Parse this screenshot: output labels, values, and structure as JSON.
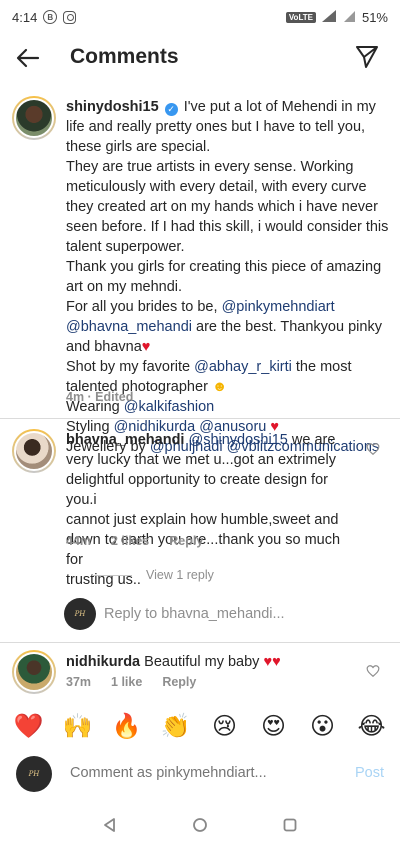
{
  "status_bar": {
    "time": "4:14",
    "battery": "51%",
    "network": "VoLTE",
    "signal": "4G"
  },
  "header": {
    "title": "Comments"
  },
  "main_comment": {
    "username": "shinydoshi15",
    "line1": "I've put a lot of Mehendi in my",
    "line2": "life and really pretty ones but I have to tell you,",
    "line3": "these girls are special.",
    "line4": "They are true artists in every sense. Working",
    "line5": "meticulously with every detail, with every curve",
    "line6": "they created art on my hands which i have never",
    "line7": "seen before. If I had this skill, i would consider this",
    "line8": "talent superpower.",
    "line9": "Thank you girls for creating this piece of amazing",
    "line10": "art on my mehndi.",
    "line11_a": "For all you brides to be, ",
    "line11_link": "@pinkymehndiart",
    "line12_link": "@bhavna_mehandi",
    "line12_b": " are the best. Thankyou pinky",
    "line13": "and bhavna",
    "line14_a": "Shot by my favorite ",
    "line14_link": "@abhay_r_kirti",
    "line14_b": " the most",
    "line15": "talented photographer",
    "line16_a": "Wearing ",
    "line16_link": "@kalkifashion",
    "line17_a": "Styling ",
    "line17_link1": "@nidhikurda",
    "line17_link2": "@anusoru",
    "line18_a": "Jewellery by ",
    "line18_link1": "@phuljhadi",
    "line18_link2": "@vblitzcommunications",
    "meta": "4m · Edited"
  },
  "reply_comment": {
    "username": "bhavna_mehandi",
    "mention": "@shinydoshi15",
    "line1_b": " we are",
    "line2": "very lucky that we met u...got an extrimely",
    "line3": "delightful opportunity to create design for you.i",
    "line4": "cannot just explain how humble,sweet and",
    "line5": "down to earth you are...thank you so much for",
    "line6": "trusting us..",
    "time": "44m",
    "likes": "2 likes",
    "reply": "Reply",
    "view_replies": "View 1 reply",
    "reply_to": "Reply to bhavna_mehandi..."
  },
  "third_comment": {
    "username": "nidhikurda",
    "text": "Beautiful my baby",
    "time": "37m",
    "likes": "1 like",
    "reply": "Reply"
  },
  "emojis": [
    "❤️",
    "🙌",
    "🔥",
    "👏",
    "😢",
    "😍",
    "😮",
    "😂"
  ],
  "input": {
    "placeholder": "Comment as pinkymehndiart...",
    "post_label": "Post"
  },
  "colors": {
    "link": "#1e3c72",
    "verified": "#3897f0",
    "heart": "#e0162b",
    "post": "#a9d4f5"
  }
}
